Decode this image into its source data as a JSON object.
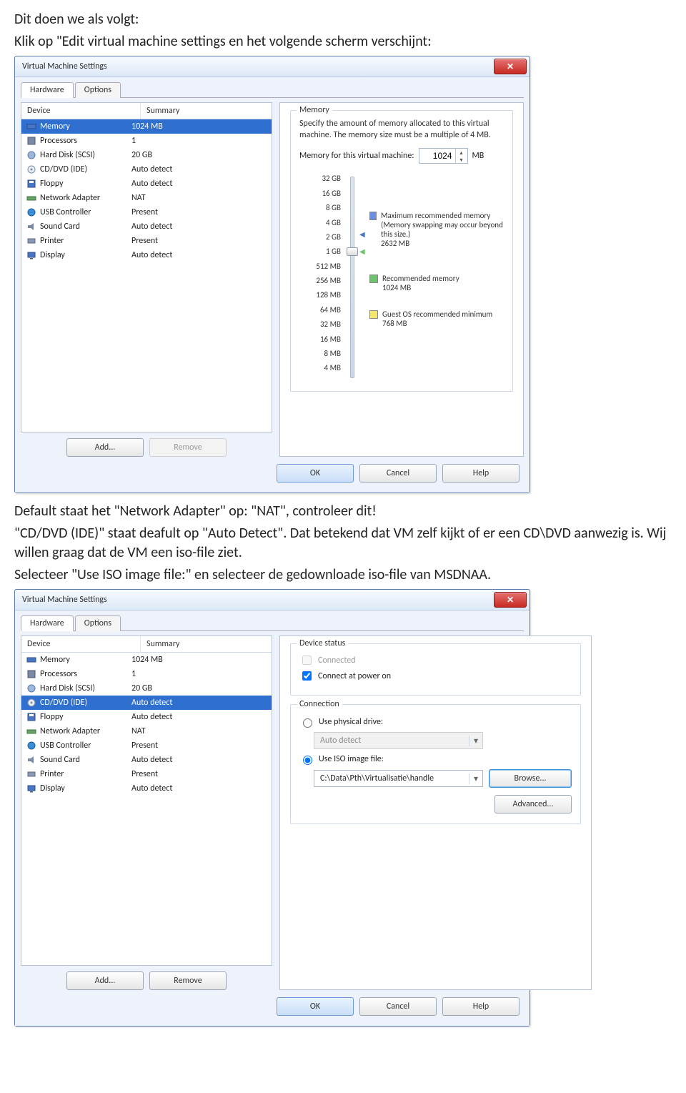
{
  "doc": {
    "p1": "Dit doen we als volgt:",
    "p2": "Klik op \"Edit virtual machine settings en het volgende scherm verschijnt:",
    "p3": "Default staat het \"Network Adapter\" op: \"NAT\", controleer dit!",
    "p4": "\"CD/DVD (IDE)\" staat deafult op \"Auto Detect\". Dat betekend dat VM zelf kijkt of er een CD\\DVD aanwezig is.  Wij willen graag dat de VM een iso-file ziet.",
    "p5": "Selecteer \"Use ISO image file:\" en selecteer de gedownloade iso-file van MSDNAA."
  },
  "dialog": {
    "title": "Virtual Machine Settings",
    "tabs": {
      "hardware": "Hardware",
      "options": "Options"
    },
    "headers": {
      "device": "Device",
      "summary": "Summary"
    },
    "devices": [
      {
        "name": "Memory",
        "summary": "1024 MB"
      },
      {
        "name": "Processors",
        "summary": "1"
      },
      {
        "name": "Hard Disk (SCSI)",
        "summary": "20 GB"
      },
      {
        "name": "CD/DVD (IDE)",
        "summary": "Auto detect"
      },
      {
        "name": "Floppy",
        "summary": "Auto detect"
      },
      {
        "name": "Network Adapter",
        "summary": "NAT"
      },
      {
        "name": "USB Controller",
        "summary": "Present"
      },
      {
        "name": "Sound Card",
        "summary": "Auto detect"
      },
      {
        "name": "Printer",
        "summary": "Present"
      },
      {
        "name": "Display",
        "summary": "Auto detect"
      }
    ],
    "add": "Add...",
    "remove": "Remove",
    "ok": "OK",
    "cancel": "Cancel",
    "help": "Help"
  },
  "memory": {
    "group": "Memory",
    "desc": "Specify the amount of memory allocated to this virtual machine. The memory size must be a multiple of 4 MB.",
    "label": "Memory for this virtual machine:",
    "value": "1024",
    "unit": "MB",
    "ticks": [
      "32 GB",
      "16 GB",
      "8 GB",
      "4 GB",
      "2 GB",
      "1 GB",
      "512 MB",
      "256 MB",
      "128 MB",
      "64 MB",
      "32 MB",
      "16 MB",
      "8 MB",
      "4 MB"
    ],
    "legend": {
      "max_label": "Maximum recommended memory",
      "max_note": "(Memory swapping may occur beyond this size.)",
      "max_val": "2632 MB",
      "rec_label": "Recommended memory",
      "rec_val": "1024 MB",
      "min_label": "Guest OS recommended minimum",
      "min_val": "768 MB"
    }
  },
  "cdrom": {
    "status_group": "Device status",
    "connected": "Connected",
    "connect_power": "Connect at power on",
    "conn_group": "Connection",
    "use_physical": "Use physical drive:",
    "physical_value": "Auto detect",
    "use_iso": "Use ISO image file:",
    "iso_value": "C:\\Data\\Pth\\Virtualisatie\\handle",
    "browse": "Browse...",
    "advanced": "Advanced..."
  }
}
